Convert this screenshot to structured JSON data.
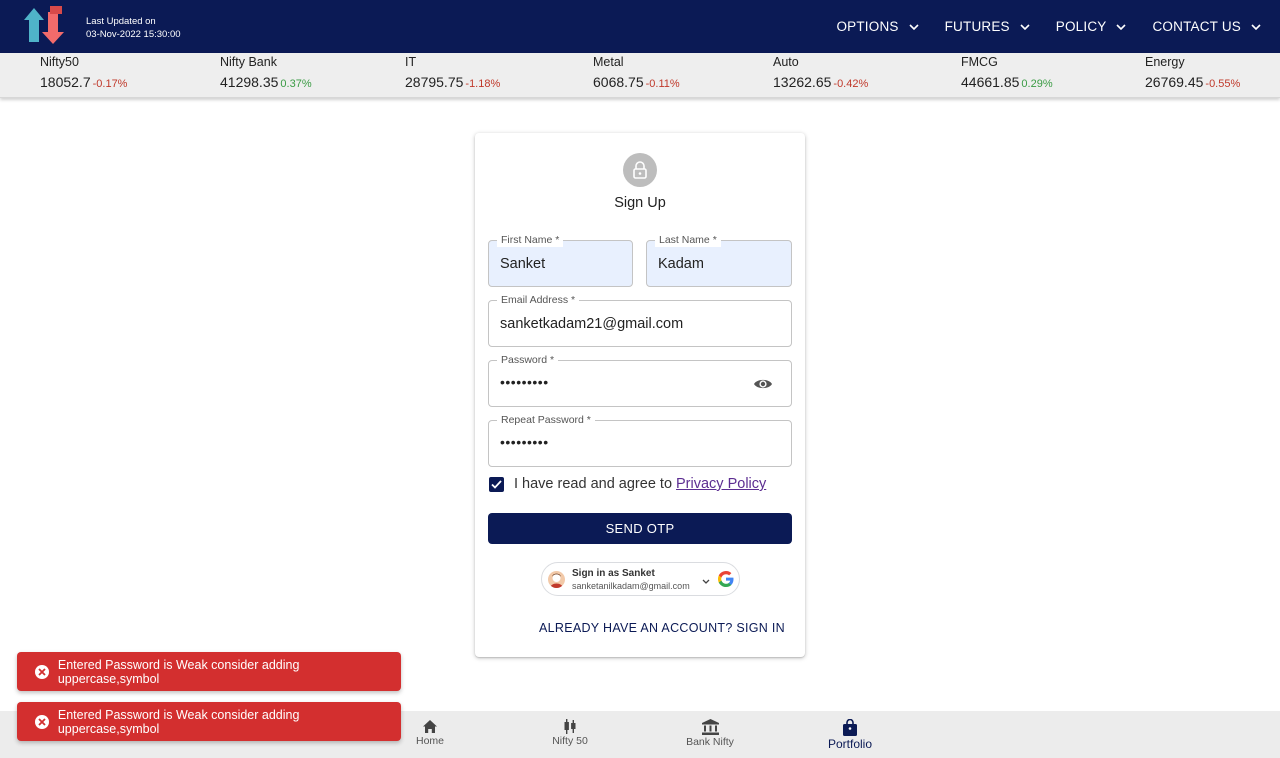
{
  "header": {
    "updated_label": "Last Updated on",
    "updated_time": "03-Nov-2022 15:30:00",
    "nav": [
      "OPTIONS",
      "FUTURES",
      "POLICY",
      "CONTACT US"
    ]
  },
  "ticker": [
    {
      "name": "Nifty50",
      "value": "18052.7",
      "change": "-0.17%",
      "dir": "neg"
    },
    {
      "name": "Nifty Bank",
      "value": "41298.35",
      "change": "0.37%",
      "dir": "pos"
    },
    {
      "name": "IT",
      "value": "28795.75",
      "change": "-1.18%",
      "dir": "neg"
    },
    {
      "name": "Metal",
      "value": "6068.75",
      "change": "-0.11%",
      "dir": "neg"
    },
    {
      "name": "Auto",
      "value": "13262.65",
      "change": "-0.42%",
      "dir": "neg"
    },
    {
      "name": "FMCG",
      "value": "44661.85",
      "change": "0.29%",
      "dir": "pos"
    },
    {
      "name": "Energy",
      "value": "26769.45",
      "change": "-0.55%",
      "dir": "neg"
    }
  ],
  "form": {
    "title": "Sign Up",
    "first_name": {
      "label": "First Name *",
      "value": "Sanket"
    },
    "last_name": {
      "label": "Last Name *",
      "value": "Kadam"
    },
    "email": {
      "label": "Email Address *",
      "value": "sanketkadam21@gmail.com"
    },
    "password": {
      "label": "Password *",
      "value": "•••••••••"
    },
    "repeat_password": {
      "label": "Repeat Password *",
      "value": "•••••••••"
    },
    "agree_text": "I have read and agree to",
    "privacy_link": "Privacy Policy",
    "agree_checked": true,
    "send_otp": "SEND OTP",
    "google": {
      "name": "Sign in as Sanket",
      "email": "sanketanilkadam@gmail.com"
    },
    "signin_link": "ALREADY HAVE AN ACCOUNT? SIGN IN"
  },
  "bottom_nav": [
    {
      "label": "Home",
      "icon": "home-icon",
      "active": false
    },
    {
      "label": "Nifty 50",
      "icon": "candlestick-icon",
      "active": false
    },
    {
      "label": "Bank Nifty",
      "icon": "bank-icon",
      "active": false
    },
    {
      "label": "Portfolio",
      "icon": "shopping-bag-icon",
      "active": true
    }
  ],
  "toasts": [
    "Entered Password is Weak consider adding uppercase,symbol",
    "Entered Password is Weak consider adding uppercase,symbol"
  ],
  "colors": {
    "navy": "#0b1a55",
    "negative": "#c0392b",
    "positive": "#3a9b44",
    "error": "#d32f2f"
  }
}
